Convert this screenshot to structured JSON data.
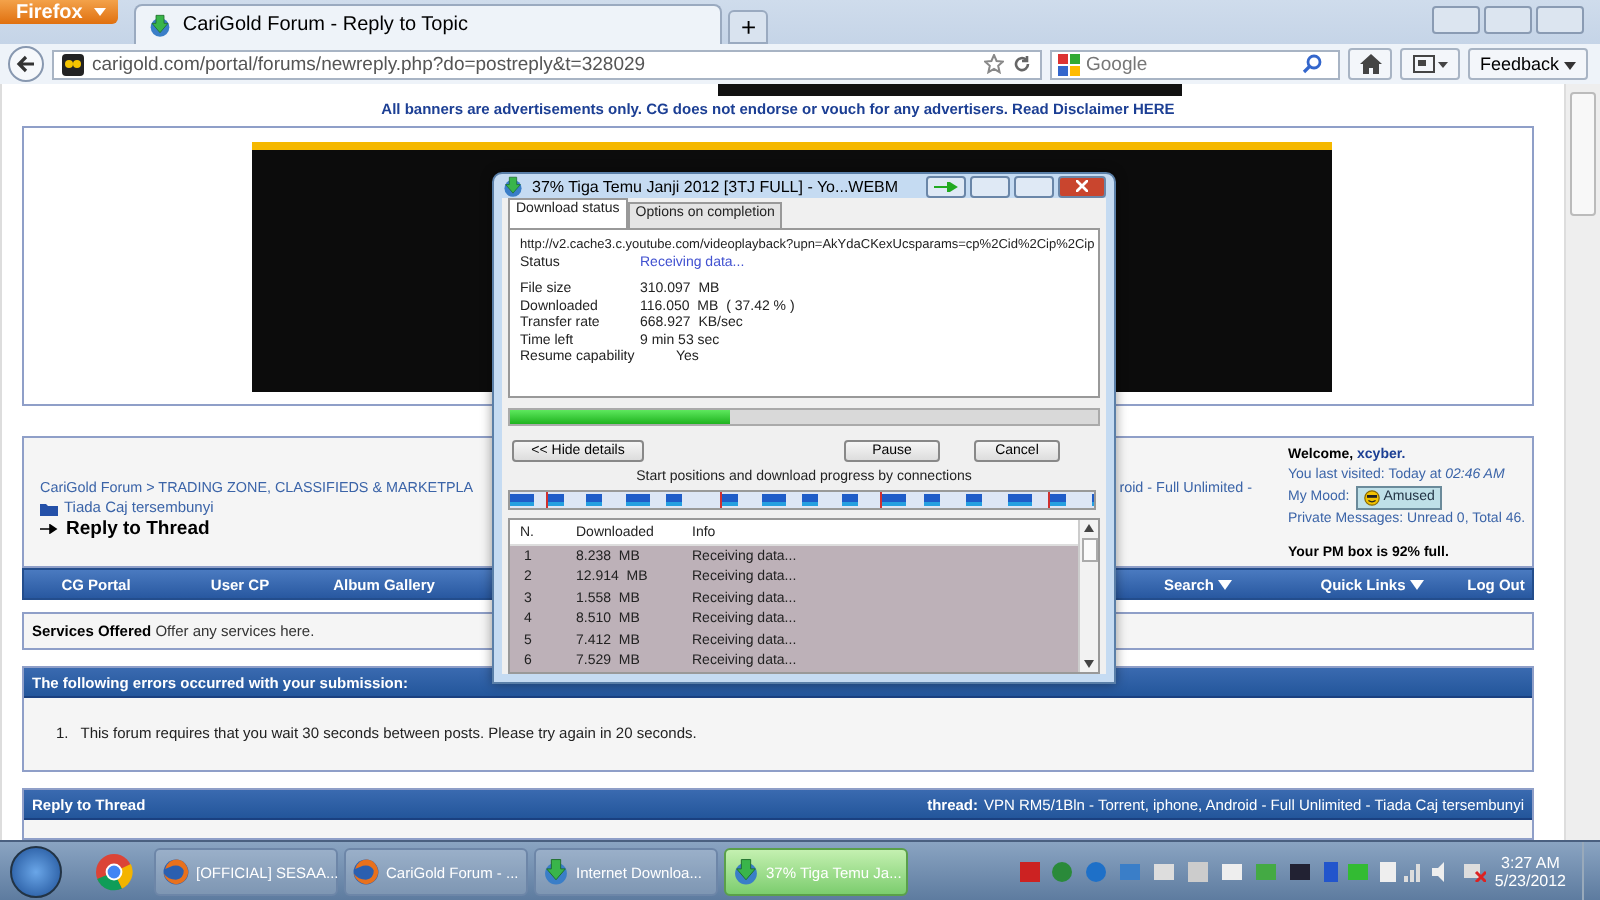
{
  "browser": {
    "menu_button": "Firefox",
    "tabs": [
      {
        "title": "CariGold Forum - Reply to Topic",
        "selected": true
      }
    ],
    "new_tab_button": "+",
    "url": "carigold.com/portal/forums/newreply.php?do=postreply&t=328029",
    "search": {
      "placeholder": "Google"
    },
    "feedback_button": "Feedback"
  },
  "forum": {
    "disclaimer": "All banners are advertisements only. CG does not endorse or vouch for any advertisers. Read Disclaimer HERE",
    "breadcrumb": {
      "path": "CariGold Forum > TRADING ZONE, CLASSIFIEDS & MARKETPLA",
      "path_continued": "roid - Full Unlimited -",
      "thread": "Tiada Caj tersembunyi",
      "current": "Reply to Thread"
    },
    "welcome": {
      "greeting": "Welcome,",
      "username": "xcyber.",
      "last_visited": "You last visited: Today at *02:46 AM*",
      "mood_label": "My Mood:",
      "mood": "Amused",
      "private_messages": "Private Messages: Unread 0, Total 46.",
      "pm_notice": "Your PM box is 92% full."
    },
    "navbar": {
      "left": [
        {
          "label": "CG Portal",
          "dropdown": false
        },
        {
          "label": "User CP",
          "dropdown": false
        },
        {
          "label": "Album Gallery",
          "dropdown": false
        }
      ],
      "right": [
        {
          "label": "Search",
          "dropdown": true
        },
        {
          "label": "Quick Links",
          "dropdown": true
        },
        {
          "label": "Log Out",
          "dropdown": false
        }
      ]
    },
    "services": "**Services Offered** Offer any services here.",
    "errors": {
      "title": "The following errors occurred with your submission:",
      "items": [
        {
          "number": "1.",
          "text": "This forum requires that you wait 30 seconds between posts. Please try again in 20 seconds."
        }
      ]
    },
    "reply": {
      "title": "Reply to Thread",
      "thread_label": "thread:",
      "thread_title": "VPN RM5/1Bln - Torrent, iphone, Android - Full Unlimited - Tiada Caj tersembunyi"
    }
  },
  "dialog": {
    "title": "37% Tiga Temu Janji 2012 [3TJ FULL] - Yo...WEBM",
    "tabs": [
      {
        "label": "Download status",
        "selected": true
      },
      {
        "label": "Options on completion",
        "selected": false
      }
    ],
    "url": "http://v2.cache3.c.youtube.com/videoplayback?upn=AkYdaCKexUcsparams=cp%2Cid%2Cip%2Cip",
    "status": {
      "label": "Status",
      "value": "Receiving data..."
    },
    "details": [
      {
        "label": "File size",
        "value": "310.097  MB"
      },
      {
        "label": "Downloaded",
        "value": "116.050  MB  ( 37.42 % )"
      },
      {
        "label": "Transfer rate",
        "value": "668.927  KB/sec"
      },
      {
        "label": "Time left",
        "value": "9 min 53 sec"
      }
    ],
    "resume": {
      "label": "Resume capability",
      "value": "Yes"
    },
    "progress": {
      "level": 0.3742
    },
    "buttons": {
      "hide_details": "<< Hide details",
      "pause": "Pause",
      "cancel": "Cancel"
    },
    "connections_caption": "Start positions and download progress by connections",
    "connections": {
      "columns": [
        "N.",
        "Downloaded",
        "Info"
      ],
      "rows": [
        [
          "1",
          "8.238  MB",
          "Receiving data..."
        ],
        [
          "2",
          "12.914  MB",
          "Receiving data..."
        ],
        [
          "3",
          "1.558  MB",
          "Receiving data..."
        ],
        [
          "4",
          "8.510  MB",
          "Receiving data..."
        ],
        [
          "5",
          "7.412  MB",
          "Receiving data..."
        ],
        [
          "6",
          "7.529  MB",
          "Receiving data..."
        ]
      ]
    }
  },
  "taskbar": {
    "items": [
      {
        "kind": "chrome",
        "selected": false
      },
      {
        "kind": "firefox",
        "label": "[OFFICIAL] SESAA...",
        "selected": false
      },
      {
        "kind": "firefox",
        "label": "CariGold Forum - ...",
        "selected": false
      },
      {
        "kind": "idm",
        "label": "Internet Downloa...",
        "selected": false
      },
      {
        "kind": "idm",
        "label": "37% Tiga Temu Ja...",
        "selected": true
      }
    ],
    "clock": {
      "time": "3:27 AM",
      "date": "5/23/2012"
    }
  }
}
